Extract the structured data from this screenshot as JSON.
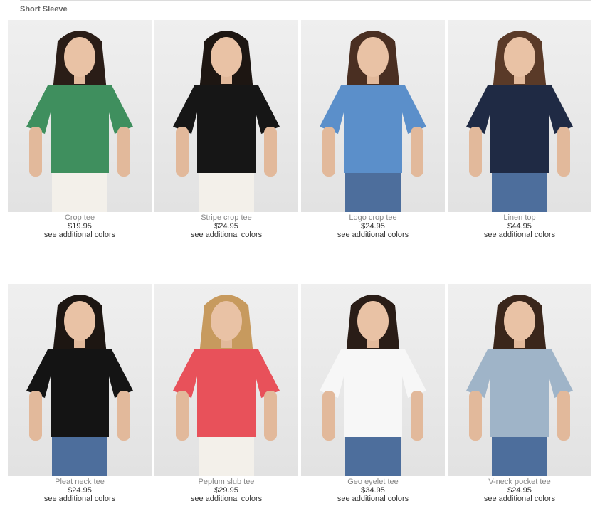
{
  "section": {
    "title": "Short Sleeve"
  },
  "products": [
    {
      "name": "Crop tee",
      "price": "$19.95",
      "colors_link": "see additional colors",
      "shirt_color": "#3f8f5e",
      "bottom_color": "#f3f0ea",
      "hair_color": "#2a1d17"
    },
    {
      "name": "Stripe crop tee",
      "price": "$24.95",
      "colors_link": "see additional colors",
      "shirt_color": "#161616",
      "bottom_color": "#f3f0ea",
      "hair_color": "#1d1612"
    },
    {
      "name": "Logo crop tee",
      "price": "$24.95",
      "colors_link": "see additional colors",
      "shirt_color": "#5b8fca",
      "bottom_color": "#4d6e9c",
      "hair_color": "#4a2f22"
    },
    {
      "name": "Linen top",
      "price": "$44.95",
      "colors_link": "see additional colors",
      "shirt_color": "#1f2a44",
      "bottom_color": "#4d6e9c",
      "hair_color": "#5a3a28"
    },
    {
      "name": "Pleat neck tee",
      "price": "$24.95",
      "colors_link": "see additional colors",
      "shirt_color": "#141414",
      "bottom_color": "#4d6e9c",
      "hair_color": "#1d1612"
    },
    {
      "name": "Peplum slub tee",
      "price": "$29.95",
      "colors_link": "see additional colors",
      "shirt_color": "#e8515a",
      "bottom_color": "#f3f0ea",
      "hair_color": "#c79a5e"
    },
    {
      "name": "Geo eyelet tee",
      "price": "$34.95",
      "colors_link": "see additional colors",
      "shirt_color": "#f7f7f7",
      "bottom_color": "#4d6e9c",
      "hair_color": "#2a1d17"
    },
    {
      "name": "V-neck pocket tee",
      "price": "$24.95",
      "colors_link": "see additional colors",
      "shirt_color": "#9fb4c8",
      "bottom_color": "#4d6e9c",
      "hair_color": "#3a261b"
    }
  ]
}
